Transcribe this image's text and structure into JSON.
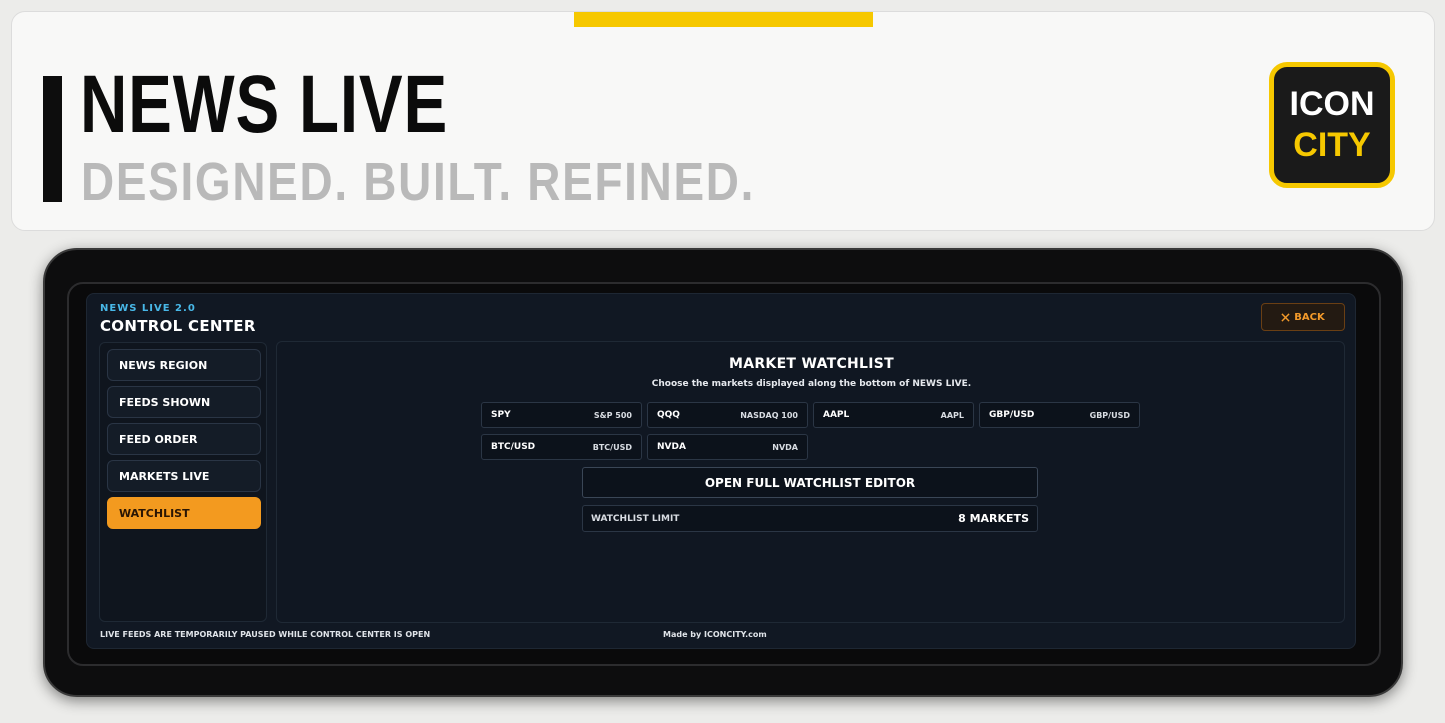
{
  "banner": {
    "title": "NEWS LIVE",
    "tagline": "DESIGNED. BUILT. REFINED.",
    "logo_line1": "ICON",
    "logo_line2": "CITY",
    "accent_color": "#f6c800"
  },
  "app": {
    "kicker": "NEWS LIVE 2.0",
    "title": "CONTROL CENTER",
    "back_icon": "close-icon",
    "back_label": "BACK",
    "accent_color": "#f39a1f"
  },
  "sidebar": {
    "items": [
      {
        "label": "NEWS REGION",
        "active": false
      },
      {
        "label": "FEEDS SHOWN",
        "active": false
      },
      {
        "label": "FEED ORDER",
        "active": false
      },
      {
        "label": "MARKETS LIVE",
        "active": false
      },
      {
        "label": "WATCHLIST",
        "active": true
      }
    ]
  },
  "main": {
    "title": "MARKET WATCHLIST",
    "subtitle": "Choose the markets displayed along the bottom of NEWS LIVE.",
    "markets": [
      {
        "symbol": "SPY",
        "name": "S&P 500"
      },
      {
        "symbol": "QQQ",
        "name": "NASDAQ 100"
      },
      {
        "symbol": "AAPL",
        "name": "AAPL"
      },
      {
        "symbol": "GBP/USD",
        "name": "GBP/USD"
      },
      {
        "symbol": "BTC/USD",
        "name": "BTC/USD"
      },
      {
        "symbol": "NVDA",
        "name": "NVDA"
      }
    ],
    "open_editor_label": "OPEN FULL WATCHLIST EDITOR",
    "limit_label": "WATCHLIST LIMIT",
    "limit_value": "8 MARKETS"
  },
  "footer": {
    "status": "LIVE FEEDS ARE TEMPORARILY PAUSED WHILE CONTROL CENTER IS OPEN",
    "credit": "Made by ICONCITY.com"
  }
}
